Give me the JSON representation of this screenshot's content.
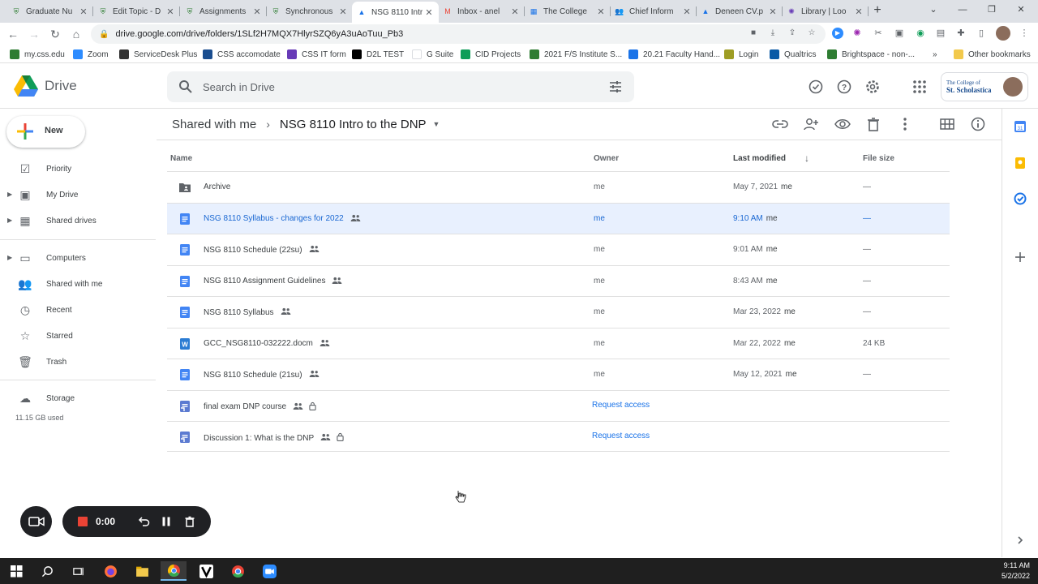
{
  "browser": {
    "tabs": [
      {
        "label": "Graduate Nu",
        "icon": "shield"
      },
      {
        "label": "Edit Topic - D",
        "icon": "shield"
      },
      {
        "label": "Assignments",
        "icon": "shield"
      },
      {
        "label": "Synchronous",
        "icon": "shield"
      },
      {
        "label": "NSG 8110 Intr",
        "icon": "drive",
        "active": true
      },
      {
        "label": "Inbox - anel",
        "icon": "gmail"
      },
      {
        "label": "The College",
        "icon": "calendar"
      },
      {
        "label": "Chief Inform",
        "icon": "people"
      },
      {
        "label": "Deneen CV.p",
        "icon": "drive"
      },
      {
        "label": "Library | Loo",
        "icon": "gear"
      }
    ],
    "url": "drive.google.com/drive/folders/1SLf2H7MQX7HlyrSZQ6yA3uAoTuu_Pb3",
    "bookmarks": [
      {
        "label": "my.css.edu",
        "color": "#2e7d32"
      },
      {
        "label": "Zoom",
        "color": "#2d8cff"
      },
      {
        "label": "ServiceDesk Plus",
        "color": "#333333"
      },
      {
        "label": "CSS accomodate",
        "color": "#1a4d8f"
      },
      {
        "label": "CSS IT form",
        "color": "#673ab7"
      },
      {
        "label": "D2L TEST",
        "color": "#000000"
      },
      {
        "label": "G Suite",
        "color": "#ffffff"
      },
      {
        "label": "CID Projects",
        "color": "#0f9d58"
      },
      {
        "label": "2021 F/S Institute S...",
        "color": "#2e7d32"
      },
      {
        "label": "20.21 Faculty Hand...",
        "color": "#1a73e8"
      },
      {
        "label": "Login",
        "color": "#9e9d24"
      },
      {
        "label": "Qualtrics",
        "color": "#0a5aa6"
      },
      {
        "label": "Brightspace - non-...",
        "color": "#2e7d32"
      }
    ],
    "other_bookmarks": "Other bookmarks",
    "bm_more": "»"
  },
  "drive": {
    "app_title": "Drive",
    "search_placeholder": "Search in Drive",
    "org_name_line1": "The College of",
    "org_name_line2": "St. Scholastica",
    "new_label": "New",
    "sidebar": [
      {
        "label": "Priority",
        "icon": "priority-icon",
        "glyph": "☑"
      },
      {
        "label": "My Drive",
        "icon": "my-drive-icon",
        "glyph": "▣",
        "caret": true
      },
      {
        "label": "Shared drives",
        "icon": "shared-drives-icon",
        "glyph": "▦",
        "caret": true
      },
      {
        "label": "Computers",
        "icon": "computers-icon",
        "glyph": "▭",
        "caret": true
      },
      {
        "label": "Shared with me",
        "icon": "shared-with-me-icon",
        "glyph": "👥"
      },
      {
        "label": "Recent",
        "icon": "recent-icon",
        "glyph": "◷"
      },
      {
        "label": "Starred",
        "icon": "starred-icon",
        "glyph": "☆"
      },
      {
        "label": "Trash",
        "icon": "trash-icon",
        "glyph": "🗑"
      }
    ],
    "storage_label": "Storage",
    "storage_used": "11.15 GB used",
    "breadcrumb": {
      "parent": "Shared with me",
      "current": "NSG 8110 Intro to the DNP"
    },
    "columns": {
      "name": "Name",
      "owner": "Owner",
      "modified": "Last modified",
      "size": "File size"
    },
    "files": [
      {
        "name": "Archive",
        "type": "shared-folder",
        "owner": "me",
        "modified": "May 7, 2021",
        "by": "me",
        "size": "—",
        "shared": false
      },
      {
        "name": "NSG 8110 Syllabus - changes for 2022",
        "type": "doc",
        "owner": "me",
        "modified": "9:10 AM",
        "by": "me",
        "size": "—",
        "shared": true,
        "selected": true
      },
      {
        "name": "NSG 8110 Schedule (22su)",
        "type": "doc",
        "owner": "me",
        "modified": "9:01 AM",
        "by": "me",
        "size": "—",
        "shared": true
      },
      {
        "name": "NSG 8110 Assignment Guidelines",
        "type": "doc",
        "owner": "me",
        "modified": "8:43 AM",
        "by": "me",
        "size": "—",
        "shared": true
      },
      {
        "name": "NSG 8110 Syllabus",
        "type": "doc",
        "owner": "me",
        "modified": "Mar 23, 2022",
        "by": "me",
        "size": "—",
        "shared": true
      },
      {
        "name": "GCC_NSG8110-032222.docm",
        "type": "word",
        "owner": "me",
        "modified": "Mar 22, 2022",
        "by": "me",
        "size": "24 KB",
        "shared": true
      },
      {
        "name": "NSG 8110 Schedule (21su)",
        "type": "doc",
        "owner": "me",
        "modified": "May 12, 2021",
        "by": "me",
        "size": "—",
        "shared": true
      },
      {
        "name": "final exam DNP course",
        "type": "shortcut",
        "shared": true,
        "locked": true,
        "request": "Request access"
      },
      {
        "name": "Discussion 1:  What is the DNP",
        "type": "shortcut",
        "shared": true,
        "locked": true,
        "request": "Request access"
      }
    ]
  },
  "recorder": {
    "time": "0:00"
  },
  "taskbar": {
    "time": "9:11 AM",
    "date": "5/2/2022"
  },
  "colors": {
    "accent": "#1a73e8",
    "selected_row": "#e8f0fe",
    "record_red": "#ea4335"
  }
}
